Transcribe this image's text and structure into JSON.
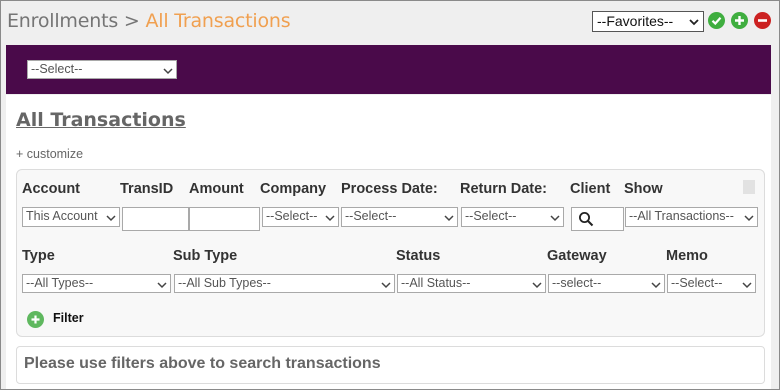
{
  "header": {
    "breadcrumb_parent": "Enrollments",
    "breadcrumb_separator": ">",
    "breadcrumb_current": "All Transactions",
    "favorites_select": "--Favorites--",
    "icons": [
      "check-circle-icon",
      "plus-circle-icon",
      "minus-circle-icon"
    ]
  },
  "toolbar": {
    "select_value": "--Select--"
  },
  "page": {
    "title": "All Transactions",
    "customize_link": "+ customize"
  },
  "filters": {
    "row1_headers": {
      "account": "Account",
      "transid": "TransID",
      "amount": "Amount",
      "company": "Company",
      "process_date": "Process Date:",
      "return_date": "Return Date:",
      "client": "Client",
      "show": "Show"
    },
    "row1_values": {
      "account": "This Account",
      "transid": "",
      "amount": "",
      "company": "--Select--",
      "process_date": "--Select--",
      "return_date": "--Select--",
      "show": "--All Transactions--"
    },
    "row2_headers": {
      "type": "Type",
      "sub_type": "Sub Type",
      "status": "Status",
      "gateway": "Gateway",
      "memo": "Memo"
    },
    "row2_values": {
      "type": "--All Types--",
      "sub_type": "--All Sub Types--",
      "status": "--All Status--",
      "gateway": "--select--",
      "memo": "--Select--"
    },
    "filter_button": "Filter"
  },
  "results": {
    "message": "Please use filters above to search transactions"
  },
  "colors": {
    "purple_bar": "#4a0a4a",
    "breadcrumb_current": "#f0a050",
    "success_green": "#3fae3f",
    "danger_red": "#cc2222"
  }
}
